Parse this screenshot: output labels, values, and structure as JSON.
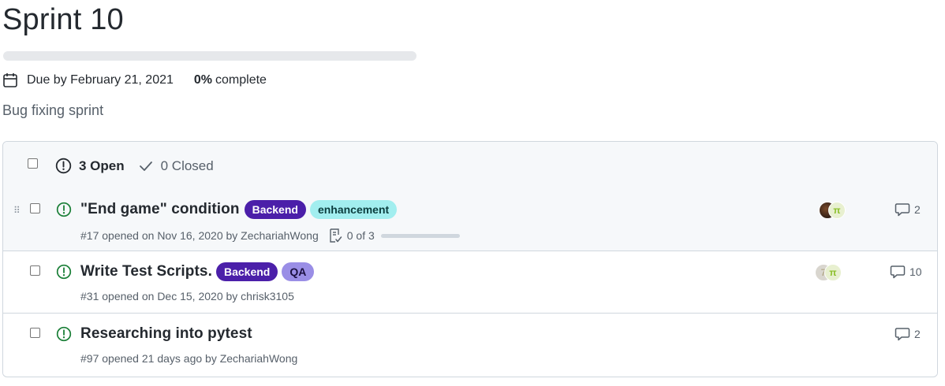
{
  "milestone": {
    "title": "Sprint 10",
    "progress_percent": 0,
    "due": "Due by February 21, 2021",
    "percent": "0%",
    "complete_label": "complete",
    "description": "Bug fixing sprint"
  },
  "states": {
    "open": "3 Open",
    "closed": "0 Closed"
  },
  "issues": [
    {
      "title": "\"End game\" condition",
      "labels": [
        {
          "name": "Backend",
          "bg": "#4b1fa9",
          "fg": "#ffffff"
        },
        {
          "name": "enhancement",
          "bg": "#a2eeef",
          "fg": "#0b3d3e"
        }
      ],
      "meta": "#17 opened on Nov 16, 2020 by ZechariahWong",
      "tasks": "0 of 3",
      "task_progress": 0,
      "comments": "2",
      "avatars": [
        "avatar-user-1",
        "avatar-user-2"
      ]
    },
    {
      "title": "Write Test Scripts.",
      "labels": [
        {
          "name": "Backend",
          "bg": "#4b1fa9",
          "fg": "#ffffff"
        },
        {
          "name": "QA",
          "bg": "#9a8ee6",
          "fg": "#1b1040"
        }
      ],
      "meta": "#31 opened on Dec 15, 2020 by chrisk3105",
      "comments": "10",
      "avatars": [
        "avatar-user-3",
        "avatar-user-2"
      ]
    },
    {
      "title": "Researching into pytest",
      "labels": [],
      "meta": "#97 opened 21 days ago by ZechariahWong",
      "comments": "2",
      "avatars": []
    }
  ],
  "colors": {
    "open_icon": "#1a7f37",
    "progress_track": "#e6e8eb",
    "muted_text": "#57606a"
  },
  "icons": [
    "calendar-icon",
    "issue-opened-icon",
    "check-icon",
    "checklist-icon",
    "comment-icon",
    "drag-handle-icon"
  ]
}
